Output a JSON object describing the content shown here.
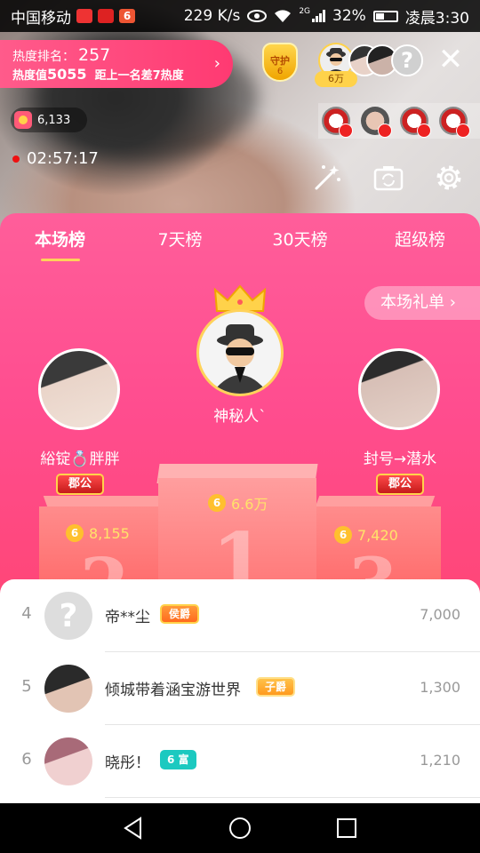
{
  "status_bar": {
    "carrier": "中国移动",
    "icon6": "6",
    "net_speed": "229 K/s",
    "net_type": "2G",
    "battery": "32%",
    "time": "凌晨3:30"
  },
  "heat": {
    "rank_label": "热度排名：",
    "rank_value": "257",
    "heat_label": "热度值",
    "heat_value": "5055",
    "gap_text": "距上一名差7热度"
  },
  "guard": {
    "label": "守护",
    "count": "6"
  },
  "top_badge": "6万",
  "coin_count": "6,133",
  "timer": "02:57:17",
  "tabs": [
    "本场榜",
    "7天榜",
    "30天榜",
    "超级榜"
  ],
  "gift_list_button": "本场礼单",
  "podium": {
    "first": {
      "name": "神秘人`",
      "score": "6.6万",
      "rank_number": "1"
    },
    "second": {
      "name": "綌锭💍胖胖",
      "badge": "郡公",
      "score": "8,155",
      "rank_number": "2"
    },
    "third": {
      "name": "封号→潜水",
      "badge": "郡公",
      "score": "7,420",
      "rank_number": "3"
    }
  },
  "coin_glyph": "6",
  "list": [
    {
      "rank": "4",
      "name": "帝**尘",
      "level": "侯爵",
      "score": "7,000"
    },
    {
      "rank": "5",
      "name": "倾城带着涵宝游世界",
      "level": "子爵",
      "score": "1,300"
    },
    {
      "rank": "6",
      "name": "晓彤！",
      "level": "6 富",
      "score": "1,210"
    }
  ],
  "colors": {
    "panel_top": "#ff5e9a",
    "panel_bottom": "#ff3c5c",
    "gold": "#ffd24a",
    "level_hou": "#ff8a1e",
    "level_zi": "#ffb01e",
    "level_fu": "#1cc9c0"
  }
}
